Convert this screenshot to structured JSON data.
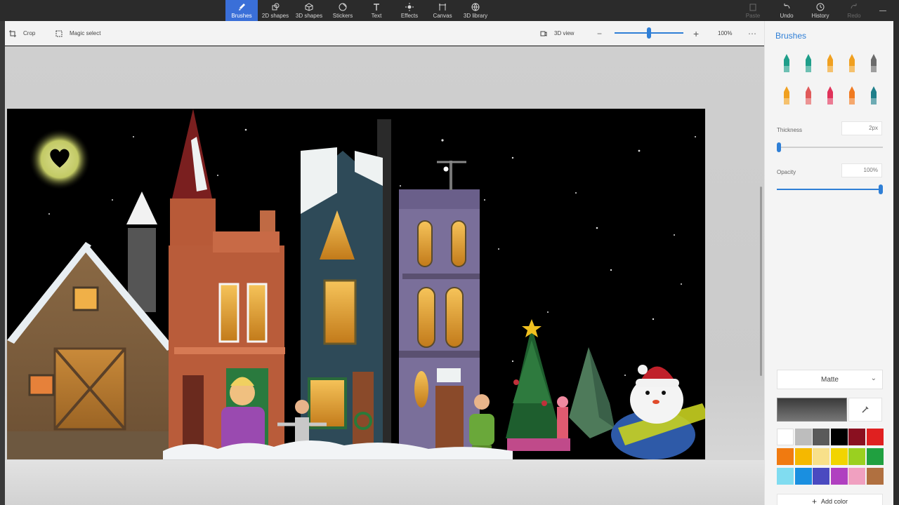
{
  "ribbon": {
    "tools": [
      {
        "label": "Brushes",
        "icon": "brush-icon",
        "active": true
      },
      {
        "label": "2D shapes",
        "icon": "2d-shapes-icon"
      },
      {
        "label": "3D shapes",
        "icon": "3d-shapes-icon"
      },
      {
        "label": "Stickers",
        "icon": "stickers-icon"
      },
      {
        "label": "Text",
        "icon": "text-icon"
      },
      {
        "label": "Effects",
        "icon": "effects-icon"
      },
      {
        "label": "Canvas",
        "icon": "canvas-icon"
      },
      {
        "label": "3D library",
        "icon": "3d-library-icon"
      }
    ],
    "paste": "Paste",
    "undo": "Undo",
    "history": "History",
    "redo": "Redo"
  },
  "subbar": {
    "crop": "Crop",
    "magic_select": "Magic select",
    "view_3d": "3D view",
    "zoom": "100%",
    "zoom_level": 0.5
  },
  "sidebar": {
    "title": "Brushes",
    "thickness_label": "Thickness",
    "thickness_value": "2px",
    "opacity_label": "Opacity",
    "opacity_value": "100%",
    "finish": "Matte",
    "add_color": "Add color",
    "brushes": [
      {
        "name": "marker",
        "color": "#1f9e8a"
      },
      {
        "name": "calligraphy-pen",
        "color": "#1f9e8a"
      },
      {
        "name": "oil-brush",
        "color": "#f0a020"
      },
      {
        "name": "watercolor",
        "color": "#f0a020"
      },
      {
        "name": "pixel-pen",
        "color": "#6b6b6b"
      },
      {
        "name": "pencil",
        "color": "#f0a020"
      },
      {
        "name": "eraser",
        "color": "#e05a5a"
      },
      {
        "name": "crayon",
        "color": "#e0335a"
      },
      {
        "name": "spray-can",
        "color": "#f07a20"
      },
      {
        "name": "fill",
        "color": "#1f7f8a"
      }
    ],
    "palette": [
      "#ffffff",
      "#bdbdbd",
      "#5a5a5a",
      "#000000",
      "#8a1020",
      "#e02020",
      "#f07a10",
      "#f5b800",
      "#f8e08a",
      "#f2d400",
      "#9ad020",
      "#20a040",
      "#80dcf0",
      "#1a8fe0",
      "#4a4ac0",
      "#b040c0",
      "#f0a0c0",
      "#b07040"
    ]
  }
}
